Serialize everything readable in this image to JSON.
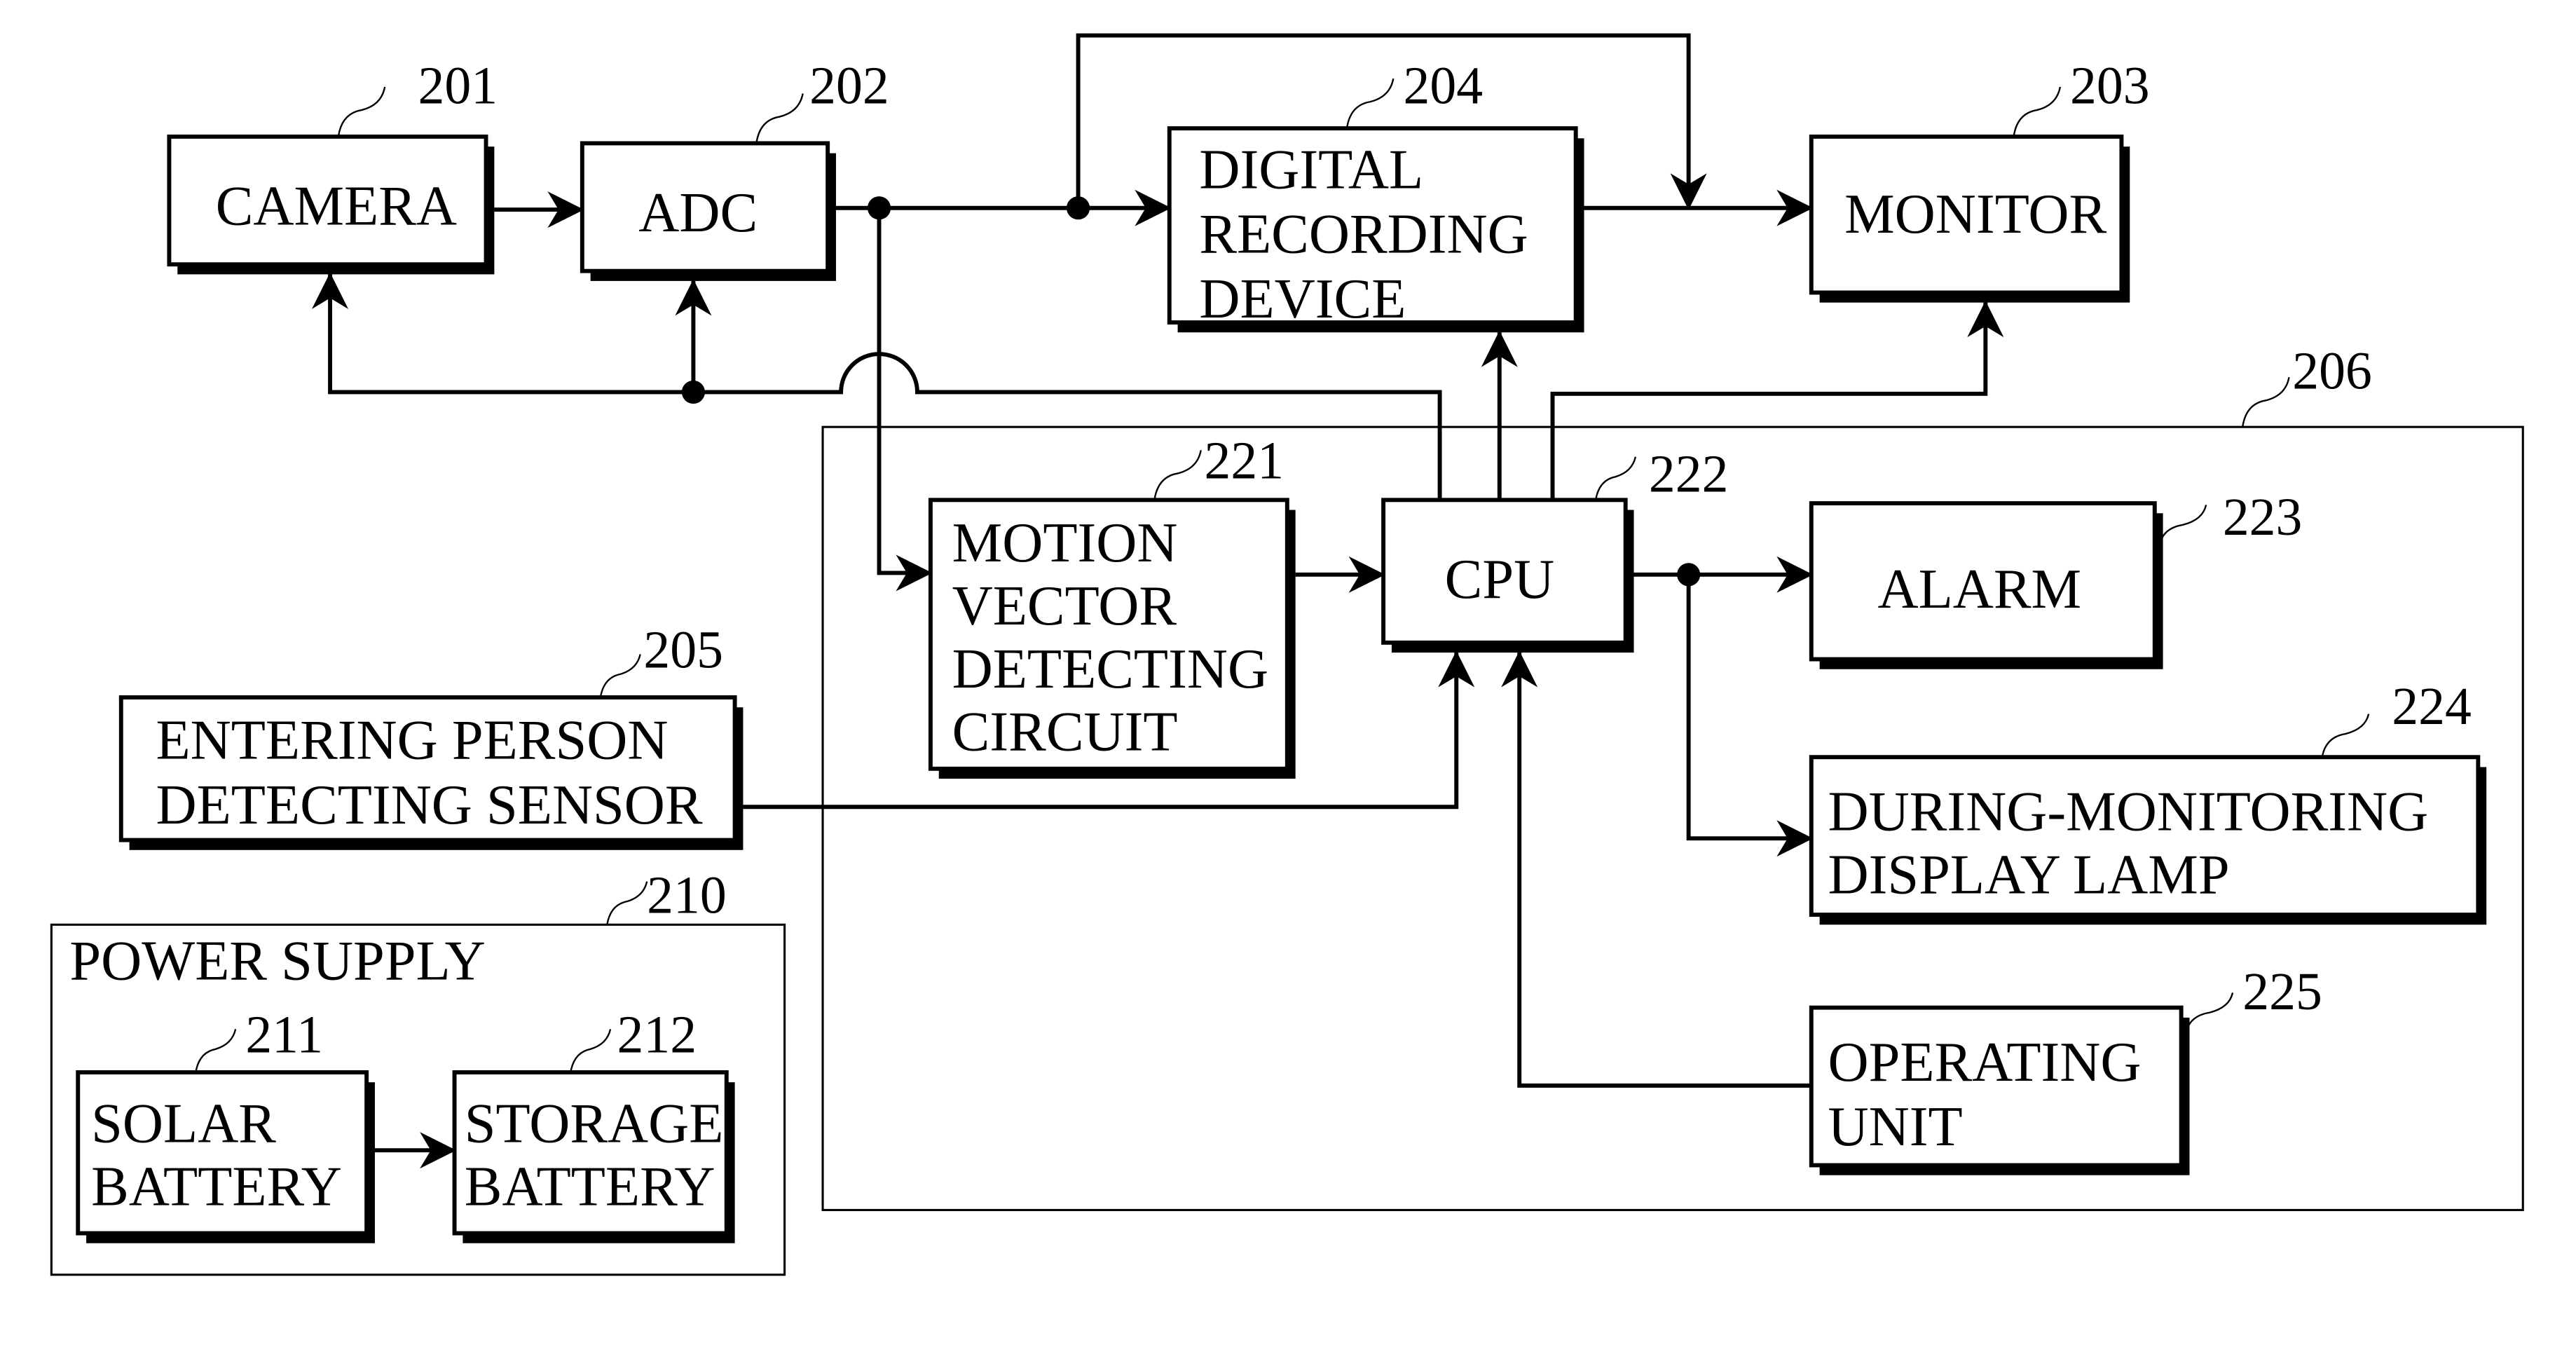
{
  "blocks": {
    "camera": {
      "ref": "201",
      "lines": [
        "CAMERA"
      ]
    },
    "adc": {
      "ref": "202",
      "lines": [
        "ADC"
      ]
    },
    "monitor": {
      "ref": "203",
      "lines": [
        "MONITOR"
      ]
    },
    "recorder": {
      "ref": "204",
      "lines": [
        "DIGITAL",
        "RECORDING",
        "DEVICE"
      ]
    },
    "sensor": {
      "ref": "205",
      "lines": [
        "ENTERING PERSON",
        "DETECTING SENSOR"
      ]
    },
    "controller": {
      "ref": "206"
    },
    "power_supply": {
      "ref": "210",
      "title": "POWER SUPPLY"
    },
    "solar": {
      "ref": "211",
      "lines": [
        "SOLAR",
        "BATTERY"
      ]
    },
    "storage": {
      "ref": "212",
      "lines": [
        "STORAGE",
        "BATTERY"
      ]
    },
    "motion": {
      "ref": "221",
      "lines": [
        "MOTION",
        "VECTOR",
        "DETECTING",
        "CIRCUIT"
      ]
    },
    "cpu": {
      "ref": "222",
      "lines": [
        "CPU"
      ]
    },
    "alarm": {
      "ref": "223",
      "lines": [
        "ALARM"
      ]
    },
    "lamp": {
      "ref": "224",
      "lines": [
        "DURING-MONITORING",
        "DISPLAY LAMP"
      ]
    },
    "operating": {
      "ref": "225",
      "lines": [
        "OPERATING",
        "UNIT"
      ]
    }
  }
}
